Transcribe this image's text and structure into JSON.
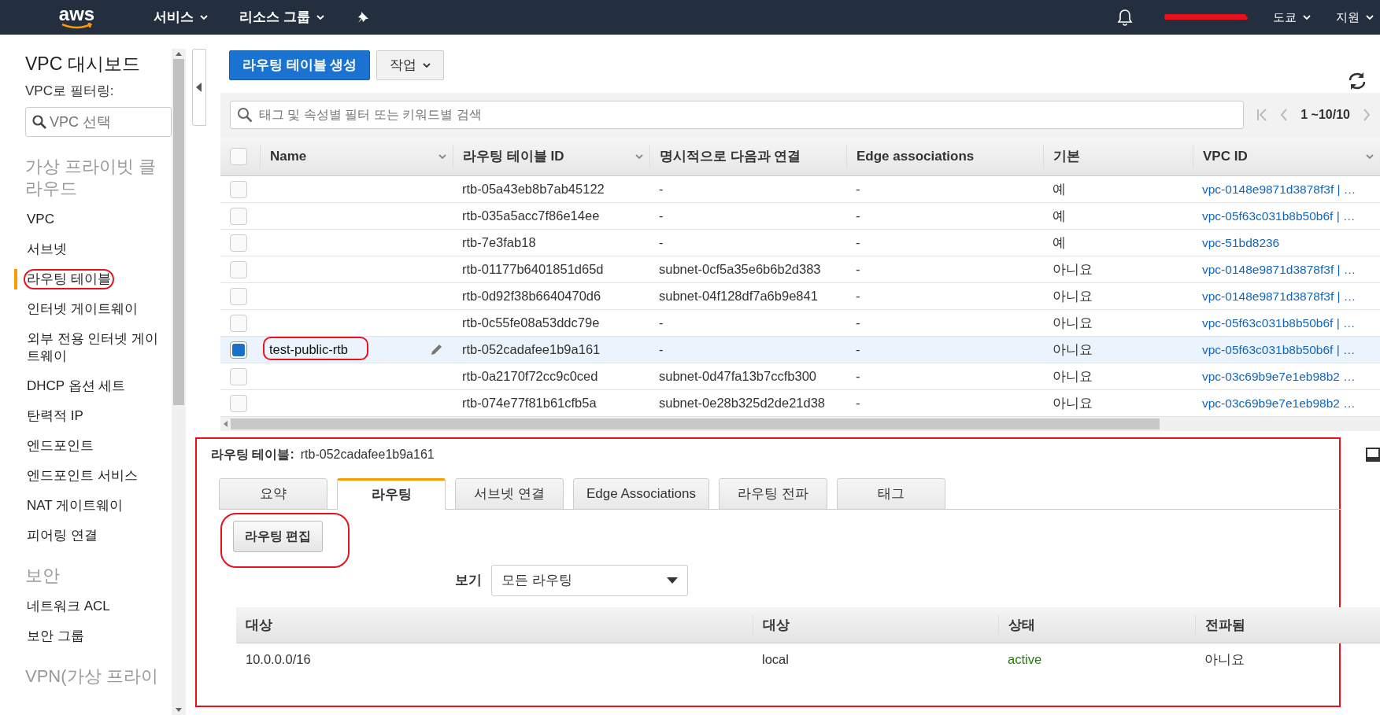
{
  "top_nav": {
    "logo": "aws",
    "menus": [
      {
        "label": "서비스"
      },
      {
        "label": "리소스 그룹"
      }
    ],
    "region": "도쿄",
    "support": "지원"
  },
  "sidebar": {
    "title": "VPC 대시보드",
    "filter_label": "VPC로 필터링:",
    "filter_placeholder": "VPC 선택",
    "sections": [
      {
        "heading": "가상 프라이빗 클라우드",
        "items": [
          {
            "label": "VPC",
            "selected": false,
            "circled": false
          },
          {
            "label": "서브넷",
            "selected": false,
            "circled": false
          },
          {
            "label": "라우팅 테이블",
            "selected": true,
            "circled": true
          },
          {
            "label": "인터넷 게이트웨이",
            "selected": false,
            "circled": false
          },
          {
            "label": "외부 전용 인터넷 게이트웨이",
            "selected": false,
            "circled": false
          },
          {
            "label": "DHCP 옵션 세트",
            "selected": false,
            "circled": false
          },
          {
            "label": "탄력적 IP",
            "selected": false,
            "circled": false
          },
          {
            "label": "엔드포인트",
            "selected": false,
            "circled": false
          },
          {
            "label": "엔드포인트 서비스",
            "selected": false,
            "circled": false
          },
          {
            "label": "NAT 게이트웨이",
            "selected": false,
            "circled": false
          },
          {
            "label": "피어링 연결",
            "selected": false,
            "circled": false
          }
        ]
      },
      {
        "heading": "보안",
        "items": [
          {
            "label": "네트워크 ACL",
            "selected": false,
            "circled": false
          },
          {
            "label": "보안 그룹",
            "selected": false,
            "circled": false
          }
        ]
      },
      {
        "heading": "VPN(가상 프라이"
      }
    ]
  },
  "toolbar": {
    "create_button": "라우팅 테이블 생성",
    "actions_button": "작업"
  },
  "search": {
    "placeholder": "태그 및 속성별 필터 또는 키워드별 검색"
  },
  "pagination": "1 ~10/10",
  "table": {
    "select_all_checked": false,
    "columns": [
      "Name",
      "라우팅 테이블 ID",
      "명시적으로 다음과 연결",
      "Edge associations",
      "기본",
      "VPC ID"
    ],
    "rows": [
      {
        "selected": false,
        "name": "",
        "name_circled": false,
        "id": "rtb-05a43eb8b7ab45122",
        "explicit": "-",
        "edge": "-",
        "main": "예",
        "vpc": "vpc-0148e9871d3878f3f | …"
      },
      {
        "selected": false,
        "name": "",
        "name_circled": false,
        "id": "rtb-035a5acc7f86e14ee",
        "explicit": "-",
        "edge": "-",
        "main": "예",
        "vpc": "vpc-05f63c031b8b50b6f | …"
      },
      {
        "selected": false,
        "name": "",
        "name_circled": false,
        "id": "rtb-7e3fab18",
        "explicit": "-",
        "edge": "-",
        "main": "예",
        "vpc": "vpc-51bd8236"
      },
      {
        "selected": false,
        "name": "",
        "name_circled": false,
        "id": "rtb-01177b6401851d65d",
        "explicit": "subnet-0cf5a35e6b6b2d383",
        "edge": "-",
        "main": "아니요",
        "vpc": "vpc-0148e9871d3878f3f | …"
      },
      {
        "selected": false,
        "name": "",
        "name_circled": false,
        "id": "rtb-0d92f38b6640470d6",
        "explicit": "subnet-04f128df7a6b9e841",
        "edge": "-",
        "main": "아니요",
        "vpc": "vpc-0148e9871d3878f3f | …"
      },
      {
        "selected": false,
        "name": "",
        "name_circled": false,
        "id": "rtb-0c55fe08a53ddc79e",
        "explicit": "-",
        "edge": "-",
        "main": "아니요",
        "vpc": "vpc-05f63c031b8b50b6f | …"
      },
      {
        "selected": true,
        "name": "test-public-rtb",
        "name_circled": true,
        "id": "rtb-052cadafee1b9a161",
        "explicit": "-",
        "edge": "-",
        "main": "아니요",
        "vpc": "vpc-05f63c031b8b50b6f | …"
      },
      {
        "selected": false,
        "name": "",
        "name_circled": false,
        "id": "rtb-0a2170f72cc9c0ced",
        "explicit": "subnet-0d47fa13b7ccfb300",
        "edge": "-",
        "main": "아니요",
        "vpc": "vpc-03c69b9e7e1eb98b2 …"
      },
      {
        "selected": false,
        "name": "",
        "name_circled": false,
        "id": "rtb-074e77f81b61cfb5a",
        "explicit": "subnet-0e28b325d2de21d38",
        "edge": "-",
        "main": "아니요",
        "vpc": "vpc-03c69b9e7e1eb98b2 …"
      }
    ]
  },
  "detail": {
    "outlined": true,
    "title_label": "라우팅 테이블:",
    "title_value": "rtb-052cadafee1b9a161",
    "tabs": [
      {
        "label": "요약",
        "selected": false
      },
      {
        "label": "라우팅",
        "selected": true
      },
      {
        "label": "서브넷 연결",
        "selected": false
      },
      {
        "label": "Edge Associations",
        "selected": false
      },
      {
        "label": "라우팅 전파",
        "selected": false
      },
      {
        "label": "태그",
        "selected": false
      }
    ],
    "edit_button": {
      "label": "라우팅 편집",
      "circled": true
    },
    "view_label": "보기",
    "view_value": "모든 라우팅",
    "routes": {
      "columns": [
        "대상",
        "대상",
        "상태",
        "전파됨"
      ],
      "rows": [
        {
          "destination": "10.0.0.0/16",
          "target": "local",
          "status": "active",
          "propagated": "아니요"
        }
      ]
    }
  }
}
